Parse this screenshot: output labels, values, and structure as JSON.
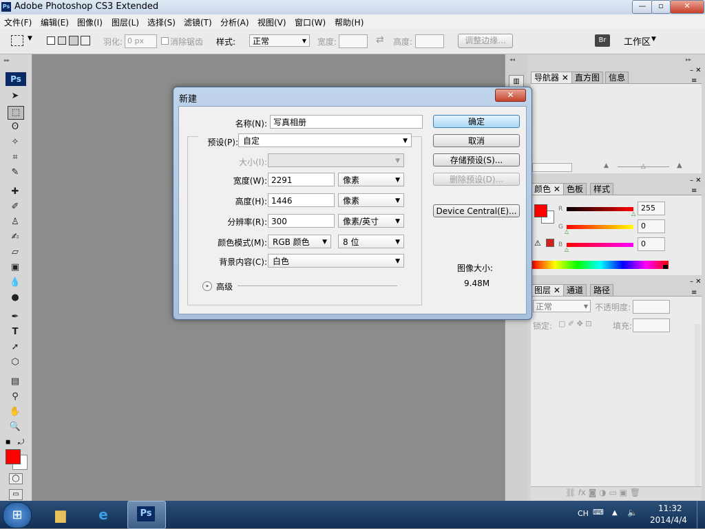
{
  "window": {
    "title": "Adobe Photoshop CS3 Extended",
    "app_badge": "Ps",
    "minimize": "—",
    "maximize": "▫",
    "close": "✕"
  },
  "menu": [
    "文件(F)",
    "编辑(E)",
    "图像(I)",
    "图层(L)",
    "选择(S)",
    "滤镜(T)",
    "分析(A)",
    "视图(V)",
    "窗口(W)",
    "帮助(H)"
  ],
  "options": {
    "feather_label": "羽化:",
    "feather_value": "0 px",
    "antialias_label": "消除锯齿",
    "style_label": "样式:",
    "style_value": "正常",
    "width_label": "宽度:",
    "height_label": "高度:",
    "refine_edge": "调整边缘...",
    "workspace": "工作区"
  },
  "toolbox": {
    "badge": "Ps",
    "fg_color": "#ff0000",
    "bg_color": "#ffffff"
  },
  "panels": {
    "nav_tabs": [
      "导航器",
      "直方图",
      "信息"
    ],
    "color_tabs": [
      "颜色",
      "色板",
      "样式"
    ],
    "color": {
      "r_label": "R",
      "g_label": "G",
      "b_label": "B",
      "r": "255",
      "g": "0",
      "b": "0",
      "fg": "#ff0000"
    },
    "layers_tabs": [
      "图层",
      "通道",
      "路径"
    ],
    "layers": {
      "blend": "正常",
      "opacity_label": "不透明度:",
      "lock_label": "锁定:",
      "fill_label": "填充:"
    }
  },
  "dialog": {
    "title": "新建",
    "name_label": "名称(N):",
    "name_value": "写真相册",
    "preset_label": "预设(P):",
    "preset_value": "自定",
    "size_label": "大小(I):",
    "size_value": "",
    "width_label": "宽度(W):",
    "width_value": "2291",
    "width_unit": "像素",
    "height_label": "高度(H):",
    "height_value": "1446",
    "height_unit": "像素",
    "res_label": "分辨率(R):",
    "res_value": "300",
    "res_unit": "像素/英寸",
    "mode_label": "颜色模式(M):",
    "mode_value": "RGB 颜色",
    "bit_value": "8 位",
    "bg_label": "背景内容(C):",
    "bg_value": "白色",
    "advanced_label": "高级",
    "ok": "确定",
    "cancel": "取消",
    "save_preset": "存储预设(S)...",
    "delete_preset": "删除预设(D)...",
    "device_central": "Device Central(E)...",
    "image_size_label": "图像大小:",
    "image_size_value": "9.48M"
  },
  "taskbar": {
    "lang": "CH",
    "time": "11:32",
    "date": "2014/4/4",
    "ps_badge": "Ps"
  }
}
